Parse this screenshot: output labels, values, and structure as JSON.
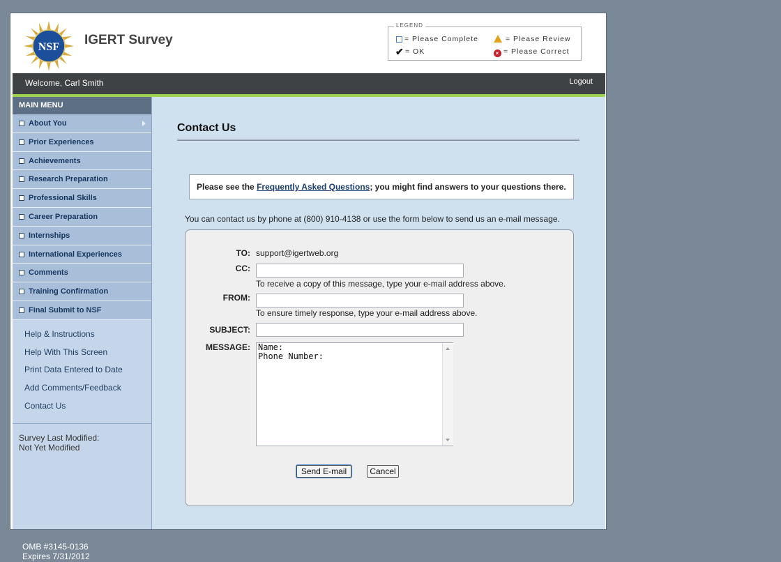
{
  "header": {
    "title": "IGERT Survey",
    "logo_text": "NSF",
    "legend": {
      "title": "LEGEND",
      "please_complete": "= Please Complete",
      "ok": "= OK",
      "please_review": "= Please Review",
      "please_correct": "= Please Correct"
    }
  },
  "topbar": {
    "welcome": "Welcome, Carl Smith",
    "logout": "Logout"
  },
  "sidebar": {
    "menu_title": "MAIN MENU",
    "items": [
      {
        "label": "About You"
      },
      {
        "label": "Prior Experiences"
      },
      {
        "label": "Achievements"
      },
      {
        "label": "Research Preparation"
      },
      {
        "label": "Professional Skills"
      },
      {
        "label": "Career Preparation"
      },
      {
        "label": "Internships"
      },
      {
        "label": "International Experiences"
      },
      {
        "label": "Comments"
      },
      {
        "label": "Training Confirmation"
      },
      {
        "label": "Final Submit to NSF"
      }
    ],
    "links": [
      "Help & Instructions",
      "Help With This Screen",
      "Print Data Entered to Date",
      "Add Comments/Feedback",
      "Contact Us"
    ],
    "survey_modified_label": "Survey Last Modified:",
    "survey_modified_value": "Not Yet Modified"
  },
  "main": {
    "page_title": "Contact Us",
    "faq_prefix": "Please see the ",
    "faq_link": "Frequently Asked Questions",
    "faq_suffix": "; you might find answers to your questions there.",
    "contact_line": "You can contact us by phone at (800) 910-4138 or use the form below to send us an e-mail message.",
    "form": {
      "to_label": "TO:",
      "to_value": "support@igertweb.org",
      "cc_label": "CC:",
      "cc_value": "",
      "cc_hint": "To receive a copy of this message, type your e-mail address above.",
      "from_label": "FROM:",
      "from_value": "",
      "from_hint": "To ensure timely response, type your e-mail address above.",
      "subject_label": "SUBJECT:",
      "subject_value": "",
      "message_label": "MESSAGE:",
      "message_value": "Name:\nPhone Number:",
      "send_label": "Send E-mail",
      "cancel_label": "Cancel"
    }
  },
  "footer": {
    "omb": "OMB #3145-0136",
    "expires": "Expires 7/31/2012"
  },
  "colors": {
    "page_bg": "#7b8898",
    "topbar": "#3f4244",
    "accent_green": "#9dd34f",
    "content_bg": "#cfe0ef",
    "sidebar_item_bg": "#a9bfd9"
  }
}
